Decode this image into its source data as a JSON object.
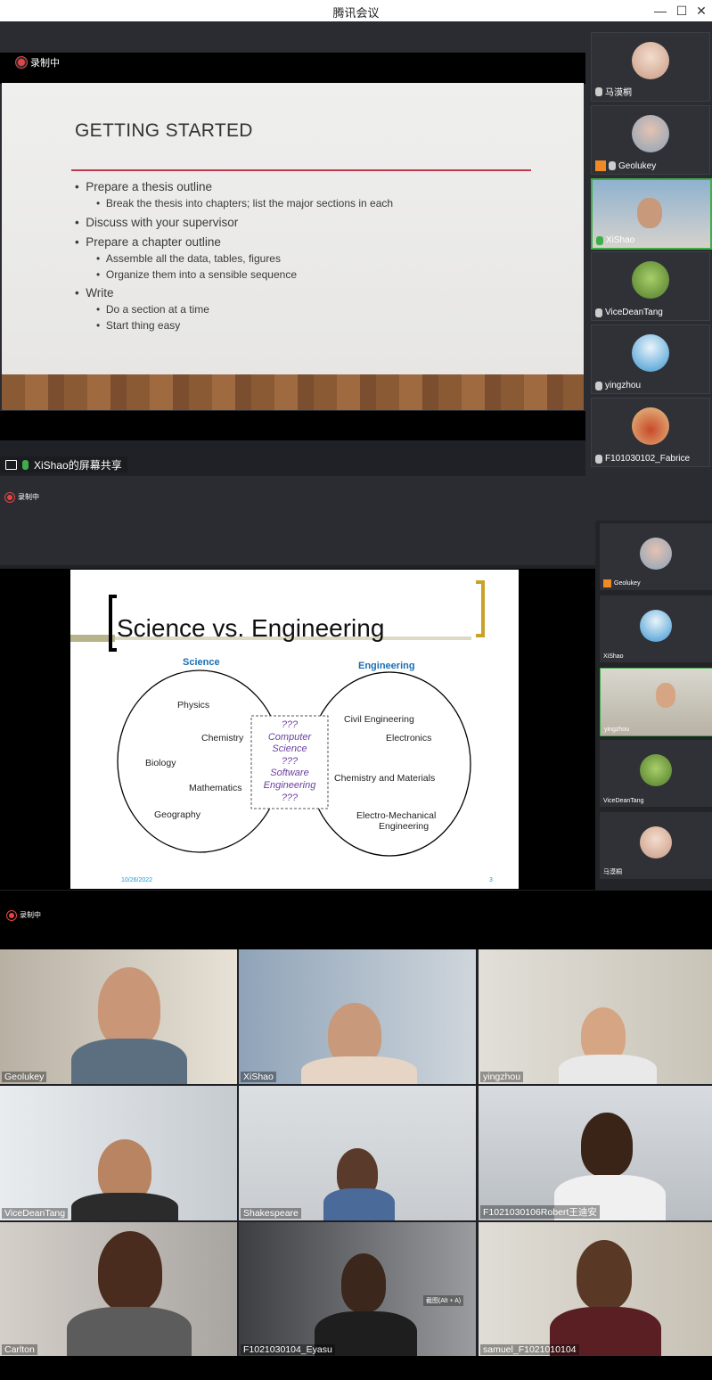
{
  "window": {
    "title": "腾讯会议",
    "controls": [
      "—",
      "☐",
      "✕"
    ]
  },
  "recording_label": "录制中",
  "slide1": {
    "title": "GETTING STARTED",
    "bullets": [
      {
        "text": "Prepare a thesis outline",
        "sub": [
          "Break the thesis into chapters; list the major sections in each"
        ]
      },
      {
        "text": "Discuss with your supervisor",
        "sub": []
      },
      {
        "text": "Prepare a chapter outline",
        "sub": [
          "Assemble all the data, tables, figures",
          "Organize them into a sensible sequence"
        ]
      },
      {
        "text": "Write",
        "sub": [
          "Do a section at a time",
          "Start thing easy"
        ]
      }
    ]
  },
  "sidebar1": {
    "participants": [
      {
        "name": "马漠桐",
        "color": "#e9c7b4"
      },
      {
        "name": "Geolukey",
        "color": "#d9b8a8"
      },
      {
        "name": "XiShao",
        "color": "#5b7ea3"
      },
      {
        "name": "ViceDeanTang",
        "color": "#6f9a3b"
      },
      {
        "name": "yingzhou",
        "color": "#5aa7d8"
      },
      {
        "name": "F101030102_Fabrice",
        "color": "#b24a2a"
      }
    ]
  },
  "share_label": "XiShao的屏幕共享",
  "slide2": {
    "title": "Science vs. Engineering",
    "left_heading": "Science",
    "right_heading": "Engineering",
    "science_items": [
      "Physics",
      "Chemistry",
      "Biology",
      "Mathematics",
      "Geography"
    ],
    "engineering_items": [
      "Civil Engineering",
      "Electronics",
      "Chemistry and Materials",
      "Electro-Mechanical",
      "Engineering"
    ],
    "middle_items": [
      "???",
      "Computer",
      "Science",
      "???",
      "Software",
      "Engineering",
      "???"
    ],
    "date": "10/26/2022",
    "page": "3"
  },
  "sidebar2": {
    "participants": [
      {
        "name": "Geolukey",
        "color": "#d9b8a8"
      },
      {
        "name": "XiShao",
        "color": "#5aa7d8"
      },
      {
        "name": "yingzhou",
        "color": "#c9a37c"
      },
      {
        "name": "ViceDeanTang",
        "color": "#6f9a3b"
      },
      {
        "name": "马漠桐",
        "color": "#e9c7b4"
      }
    ]
  },
  "gallery": {
    "tiles": [
      {
        "name": "Geolukey",
        "bg": "#cdbfa9",
        "skin": "#c99778"
      },
      {
        "name": "XiShao",
        "bg": "#9aa6b2",
        "skin": "#c8997a"
      },
      {
        "name": "yingzhou",
        "bg": "#d4d0c8",
        "skin": "#d6a583"
      },
      {
        "name": "ViceDeanTang",
        "bg": "#d8dbdf",
        "skin": "#b88462"
      },
      {
        "name": "Shakespeare",
        "bg": "#d6d9dc",
        "skin": "#5a3a2a"
      },
      {
        "name": "F1021030106Robert王迪安",
        "bg": "#cdd2d7",
        "skin": "#3a2418"
      },
      {
        "name": "Carlton",
        "bg": "#bdb8b4",
        "skin": "#4a2c1e"
      },
      {
        "name": "F1021030104_Eyasu",
        "bg": "#6d6f73",
        "skin": "#3b271c"
      },
      {
        "name": "samuel_F1021010104",
        "bg": "#d5d2cc",
        "skin": "#5a3826"
      }
    ],
    "overlay_text": "截图(Alt + A)"
  }
}
